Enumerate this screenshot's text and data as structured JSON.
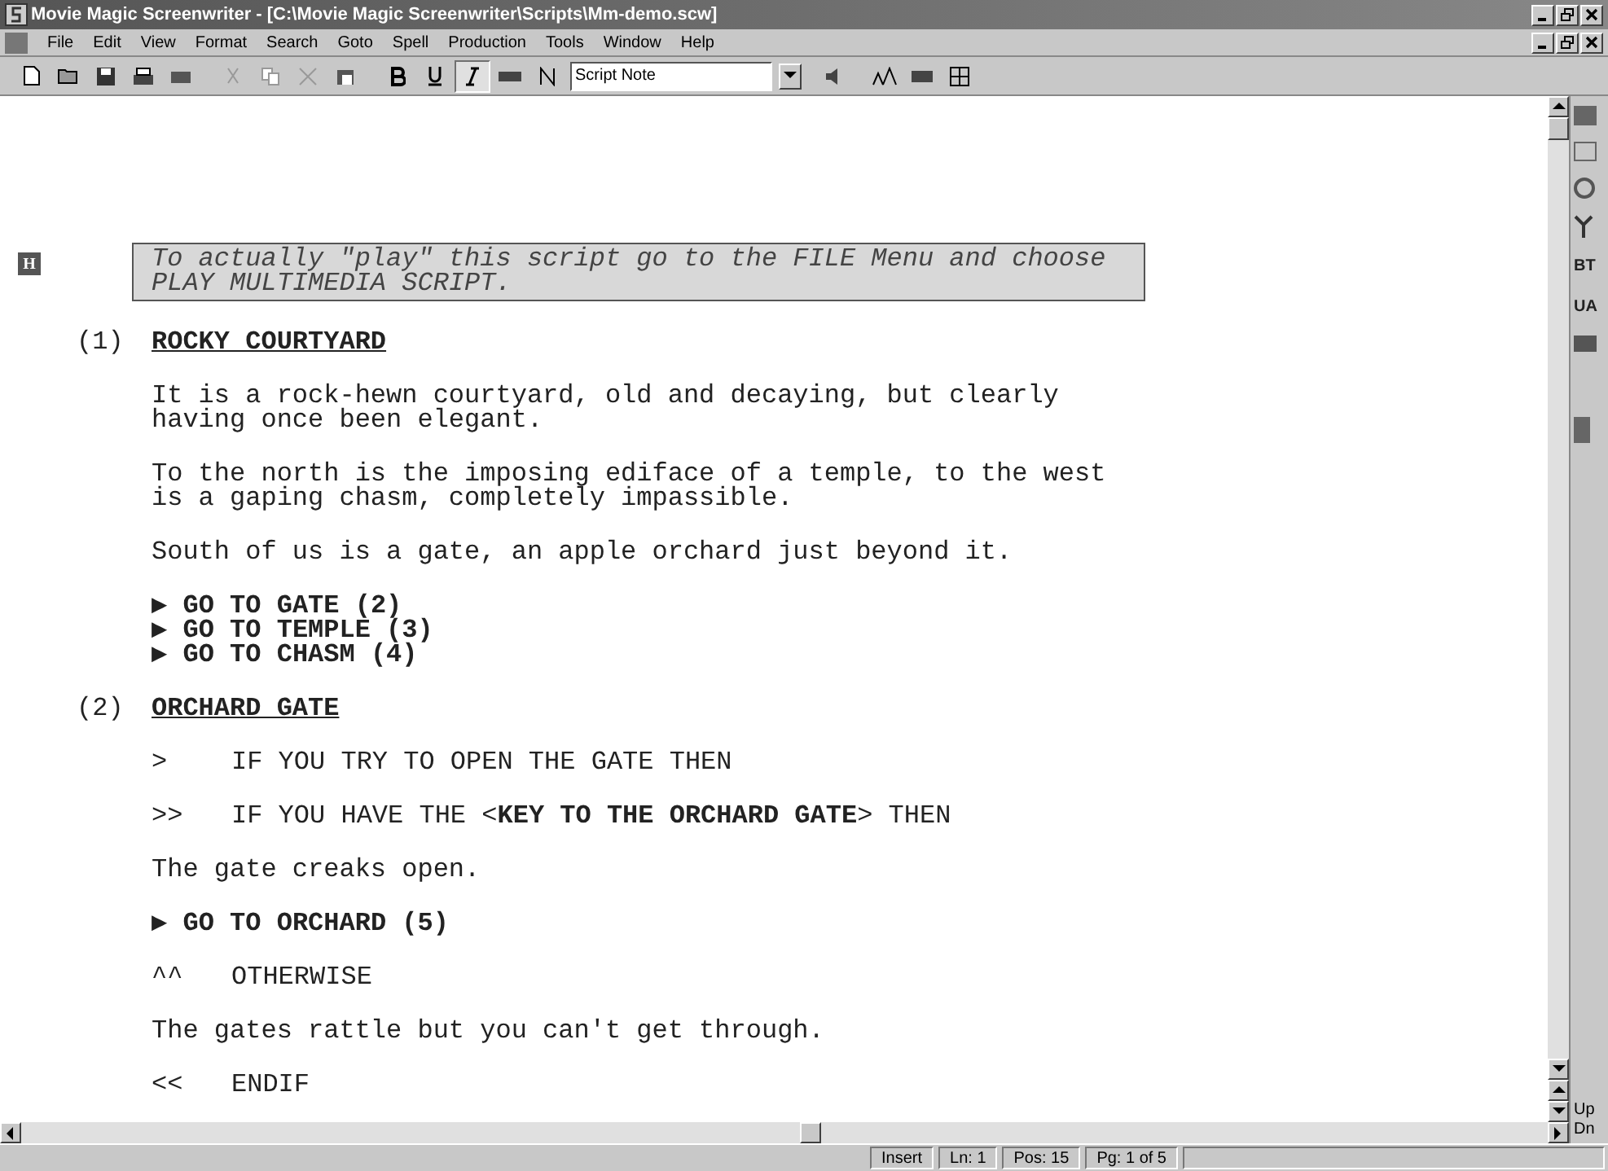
{
  "window": {
    "title": "Movie Magic Screenwriter - [C:\\Movie Magic Screenwriter\\Scripts\\Mm-demo.scw]"
  },
  "menu": [
    "File",
    "Edit",
    "View",
    "Format",
    "Search",
    "Goto",
    "Spell",
    "Production",
    "Tools",
    "Window",
    "Help"
  ],
  "toolbar": {
    "style_field": {
      "value": "Script Note"
    },
    "italic_pressed": true
  },
  "document": {
    "items": [
      {
        "kind": "note",
        "marker": "H",
        "text": "To actually \"play\" this script go to the FILE Menu and choose PLAY MULTIMEDIA SCRIPT."
      },
      {
        "kind": "scene",
        "number": "(1)",
        "text": "**ROCKY COURTYARD**"
      },
      {
        "kind": "action",
        "text": "It is a rock-hewn courtyard, old and decaying, but clearly having once been elegant."
      },
      {
        "kind": "action",
        "text": "To the north is the imposing ediface of a temple, to the west is a gaping chasm, completely impassible."
      },
      {
        "kind": "action",
        "text": "South of us is a gate, an apple orchard just beyond it."
      },
      {
        "kind": "gotos",
        "lines": [
          "▶ GO TO GATE (2)",
          "▶ GO TO TEMPLE (3)",
          "▶ GO TO CHASM (4)"
        ]
      },
      {
        "kind": "scene",
        "number": "(2)",
        "text": "**ORCHARD GATE**"
      },
      {
        "kind": "condition",
        "symbol": ">",
        "text": "IF YOU TRY TO OPEN THE GATE THEN"
      },
      {
        "kind": "condition",
        "symbol": ">>",
        "text": "IF YOU HAVE THE <**KEY TO THE ORCHARD GATE**> THEN"
      },
      {
        "kind": "action",
        "text": "The gate creaks open."
      },
      {
        "kind": "gotos",
        "lines": [
          "▶ GO TO ORCHARD (5)"
        ]
      },
      {
        "kind": "condition",
        "symbol": "^^",
        "text": "OTHERWISE"
      },
      {
        "kind": "action",
        "text": "The gates rattle but you can't get through."
      },
      {
        "kind": "condition",
        "symbol": "<<",
        "text": "ENDIF"
      }
    ]
  },
  "side_strip": [
    "BT",
    "UA"
  ],
  "scroll_labels": [
    "Up",
    "Dn"
  ],
  "status_bar": [
    "Insert",
    "Ln: 1",
    "Pos: 15",
    "Pg: 1 of 5"
  ]
}
